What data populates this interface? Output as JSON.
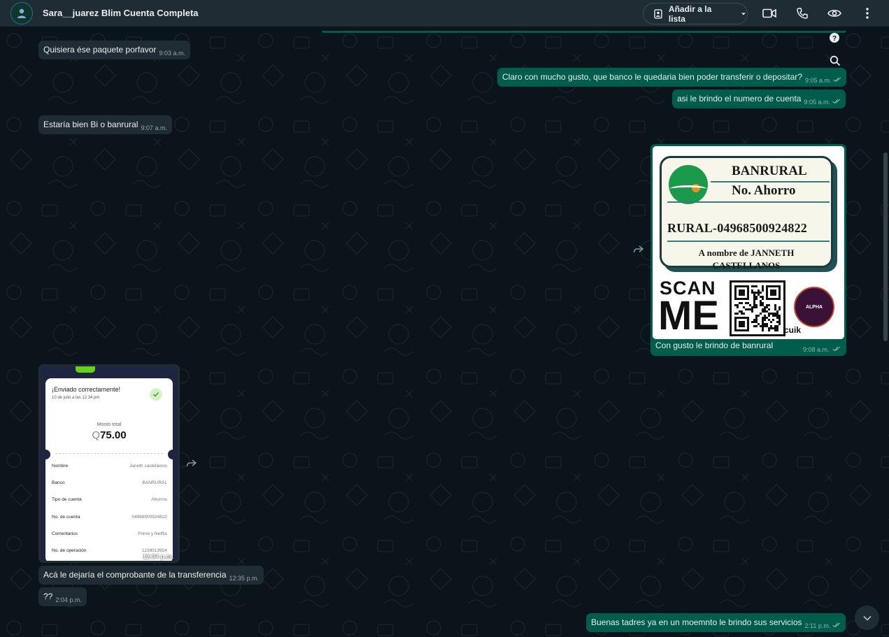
{
  "header": {
    "chat_title": "Sara__juarez Blim Cuenta Completa",
    "add_list_label": "Añadir a la lista",
    "icons": [
      "video-call-icon",
      "voice-call-icon",
      "eye-icon",
      "more-options-icon"
    ]
  },
  "messages": {
    "m1": {
      "text": "Quisiera ése paquete porfavor",
      "time": "9:03 a.m."
    },
    "m2": {
      "text": "Claro con mucho gusto, que banco le quedaria bien poder transferir o depositar?",
      "time": "9:05 a.m."
    },
    "m3": {
      "text": "asi le brindo el numero de cuenta",
      "time": "9:05 a.m."
    },
    "m4": {
      "text": "Estaría bien Bi o banrural",
      "time": "9:07 a.m."
    },
    "m5": {
      "caption": "Con gusto le brindo de banrural",
      "time": "9:08 a.m.",
      "image": {
        "bank": "BANRURAL",
        "account_type": "No. Ahorro",
        "account": "RURAL-04968500924822",
        "holder_line1": "A nombre de JANNETH",
        "holder_line2": "CASTELLANOS",
        "scan_line1": "SCAN",
        "scan_line2": "ME",
        "qr_brand": "cuik",
        "logo_text": "ALPHA"
      }
    },
    "m6": {
      "time": "12:34 p.m.",
      "receipt": {
        "title": "¡Enviado correctamente!",
        "date": "10 de julio a las 12:34 pm",
        "total_label": "Monto total",
        "currency": "Q",
        "amount": "75.00",
        "rows": [
          {
            "label": "Nombre",
            "value": "Janeth castellanos"
          },
          {
            "label": "Banco",
            "value": "BANRURAL"
          },
          {
            "label": "Tipo de cuenta",
            "value": "Ahorros"
          },
          {
            "label": "No. de cuenta",
            "value": "04968500924822"
          },
          {
            "label": "Comentarios",
            "value": "Prime y Netflix"
          },
          {
            "label": "No. de operación",
            "value": "1239013924"
          }
        ]
      }
    },
    "m7": {
      "text": "Acá le dejaría el comprobante de la transferencia",
      "time": "12:35 p.m."
    },
    "m8": {
      "text": "??",
      "time": "2:04 p.m."
    },
    "m9": {
      "text": "Buenas tadres ya en un moemnto le brindo sus servicios",
      "time": "2:11 p.m."
    }
  },
  "colors": {
    "incoming_bubble": "#202c33",
    "outgoing_bubble": "#005c4b",
    "background": "#0b141a",
    "header": "#202c33"
  }
}
